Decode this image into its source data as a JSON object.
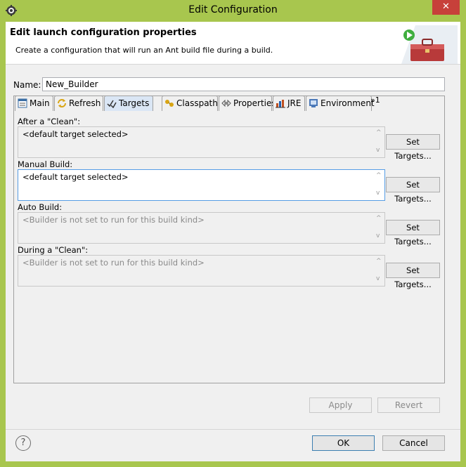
{
  "window": {
    "title": "Edit Configuration",
    "close_glyph": "✕"
  },
  "banner": {
    "title": "Edit launch configuration properties",
    "description": "Create a configuration that will run an Ant build file during a build."
  },
  "name": {
    "label": "Name:",
    "value": "New_Builder"
  },
  "tabs": [
    {
      "label": "Main",
      "icon": "main-tab-icon"
    },
    {
      "label": "Refresh",
      "icon": "refresh-icon"
    },
    {
      "label": "Targets",
      "icon": "targets-icon",
      "active": true
    },
    {
      "label": "Classpath",
      "icon": "classpath-icon"
    },
    {
      "label": "Properties",
      "icon": "properties-icon"
    },
    {
      "label": "JRE",
      "icon": "jre-icon"
    },
    {
      "label": "Environment",
      "icon": "environment-icon"
    }
  ],
  "more_tabs": {
    "label": "»1"
  },
  "sections": [
    {
      "label": "After a \"Clean\":",
      "value": "<default target selected>",
      "button": "Set Targets...",
      "enabled": true
    },
    {
      "label": "Manual Build:",
      "value": "<default target selected>",
      "button": "Set Targets...",
      "enabled": true,
      "focused": true
    },
    {
      "label": "Auto Build:",
      "value": "<Builder is not set to run for this build kind>",
      "button": "Set Targets...",
      "enabled": false
    },
    {
      "label": "During a \"Clean\":",
      "value": "<Builder is not set to run for this build kind>",
      "button": "Set Targets...",
      "enabled": false
    }
  ],
  "scroll": {
    "up": "^",
    "down": "v"
  },
  "buttons": {
    "apply": "Apply",
    "revert": "Revert",
    "ok": "OK",
    "cancel": "Cancel",
    "help": "?"
  },
  "colors": {
    "title_bar": "#a8c64e",
    "close_button": "#c7403a",
    "active_tab": "#dae6f5",
    "focus_border": "#569de5"
  }
}
